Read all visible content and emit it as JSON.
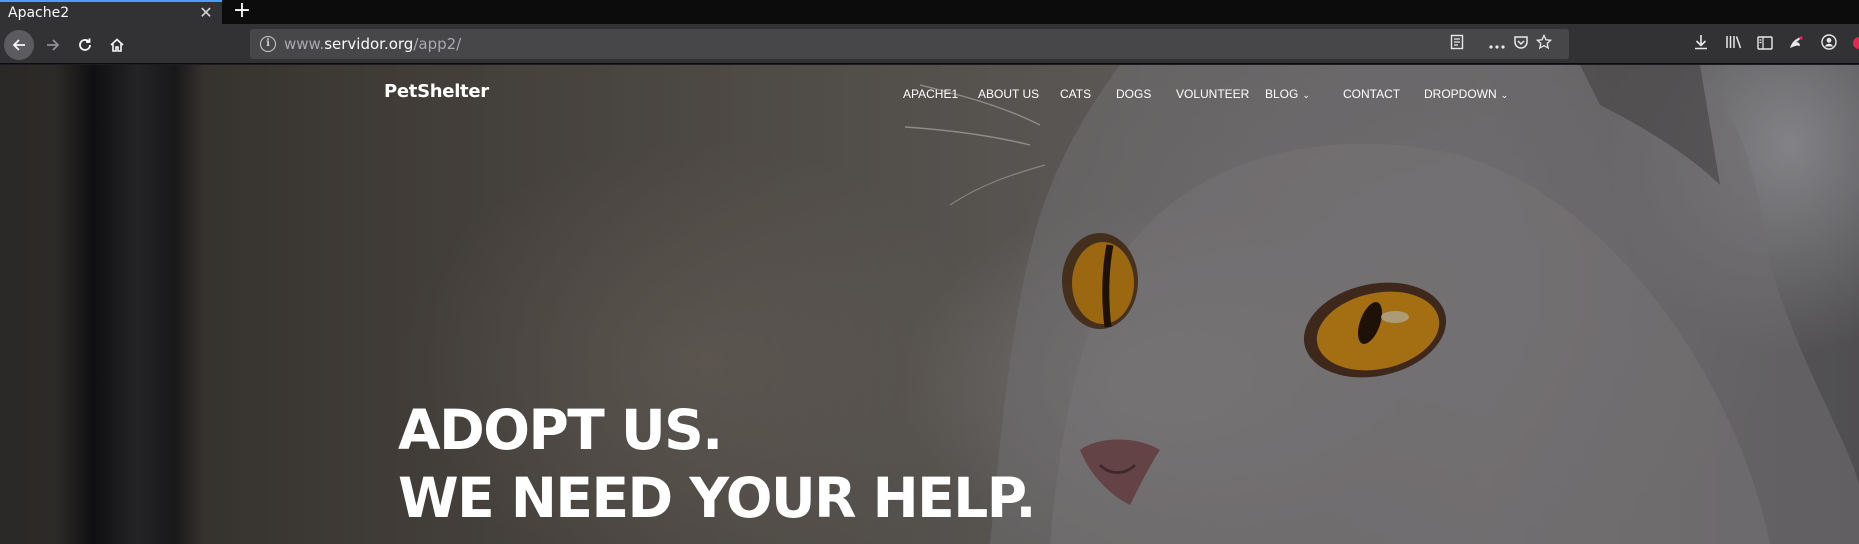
{
  "browser": {
    "tab_title": "Apache2",
    "tab_close": "✕",
    "new_tab": "+",
    "url_prefix": "www.",
    "url_host": "servidor.org",
    "url_path": "/app2/",
    "icons": {
      "back": "back-arrow-icon",
      "forward": "forward-arrow-icon",
      "reload": "reload-icon",
      "home": "home-icon",
      "info": "info-icon",
      "reader": "reader-view-icon",
      "more": "more-actions-icon",
      "pocket": "pocket-icon",
      "bookmark": "bookmark-star-icon",
      "download": "download-icon",
      "library": "library-icon",
      "sidebar": "sidebar-icon",
      "extension": "extension-icon",
      "account": "account-icon"
    }
  },
  "site": {
    "logo": "PetShelter",
    "menu": [
      {
        "label": "APACHE1"
      },
      {
        "label": "ABOUT US"
      },
      {
        "label": "CATS"
      },
      {
        "label": "DOGS"
      },
      {
        "label": "VOLUNTEER"
      },
      {
        "label": "BLOG"
      },
      {
        "label": "CONTACT"
      },
      {
        "label": "DROPDOWN"
      }
    ],
    "hero": {
      "line1": "ADOPT US.",
      "line2": "WE NEED YOUR HELP."
    }
  },
  "colors": {
    "accent": "#45a1ff",
    "toolbar": "#323234",
    "urlbar": "#474749",
    "cat_eye": "#e39a1a"
  }
}
